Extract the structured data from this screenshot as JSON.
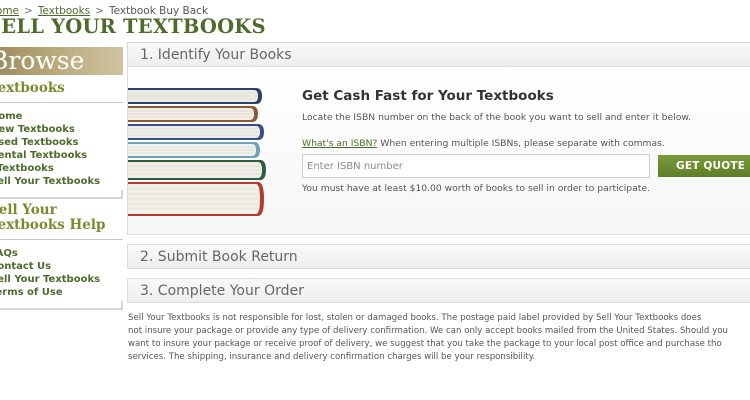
{
  "breadcrumb": {
    "home": "Home",
    "textbooks": "Textbooks",
    "current": "Textbook Buy Back",
    "separator": ">"
  },
  "page_title": "SELL YOUR TEXTBOOKS",
  "sidebar": {
    "browse_banner": "Browse",
    "textbooks_heading": "Textbooks",
    "textbooks_links": [
      "Home",
      "New Textbooks",
      "Used Textbooks",
      "Rental Textbooks",
      "eTextbooks",
      "Sell Your Textbooks"
    ],
    "help_heading_line1": "Sell Your",
    "help_heading_line2": "Textbooks Help",
    "help_links": [
      "FAQs",
      "Contact Us",
      "Sell Your Textbooks",
      "Terms of Use"
    ]
  },
  "steps": {
    "step1": "1. Identify Your Books",
    "step2": "2. Submit Book Return",
    "step3": "3. Complete Your Order"
  },
  "identify": {
    "headline": "Get Cash Fast for Your Textbooks",
    "instructions": "Locate the ISBN number on the back of the book you want to sell and enter it below.",
    "whats_isbn_link": "What's an ISBN?",
    "whats_isbn_text": " When entering multiple ISBNs, please separate with commas.",
    "isbn_placeholder": "Enter ISBN number",
    "isbn_value": "",
    "quote_button": "GET QUOTE",
    "minimum_note": "You must have at least $10.00 worth of books to sell in order to participate."
  },
  "disclaimer_lines": [
    "Sell Your Textbooks is not responsible for lost, stolen or damaged books. The postage paid label provided by Sell Your Textbooks does",
    "not insure your package or provide any type of delivery confirmation. We can only accept books mailed from the United States. Should you",
    "want to insure your package or receive proof of delivery, we suggest that you take the package to your local post office and purchase tho",
    "services. The shipping, insurance and delivery confirmation charges will be your responsibility."
  ],
  "colors": {
    "brand_green": "#4e6b2c",
    "button_green": "#6b8b32",
    "browse_banner": "#b3a474"
  }
}
